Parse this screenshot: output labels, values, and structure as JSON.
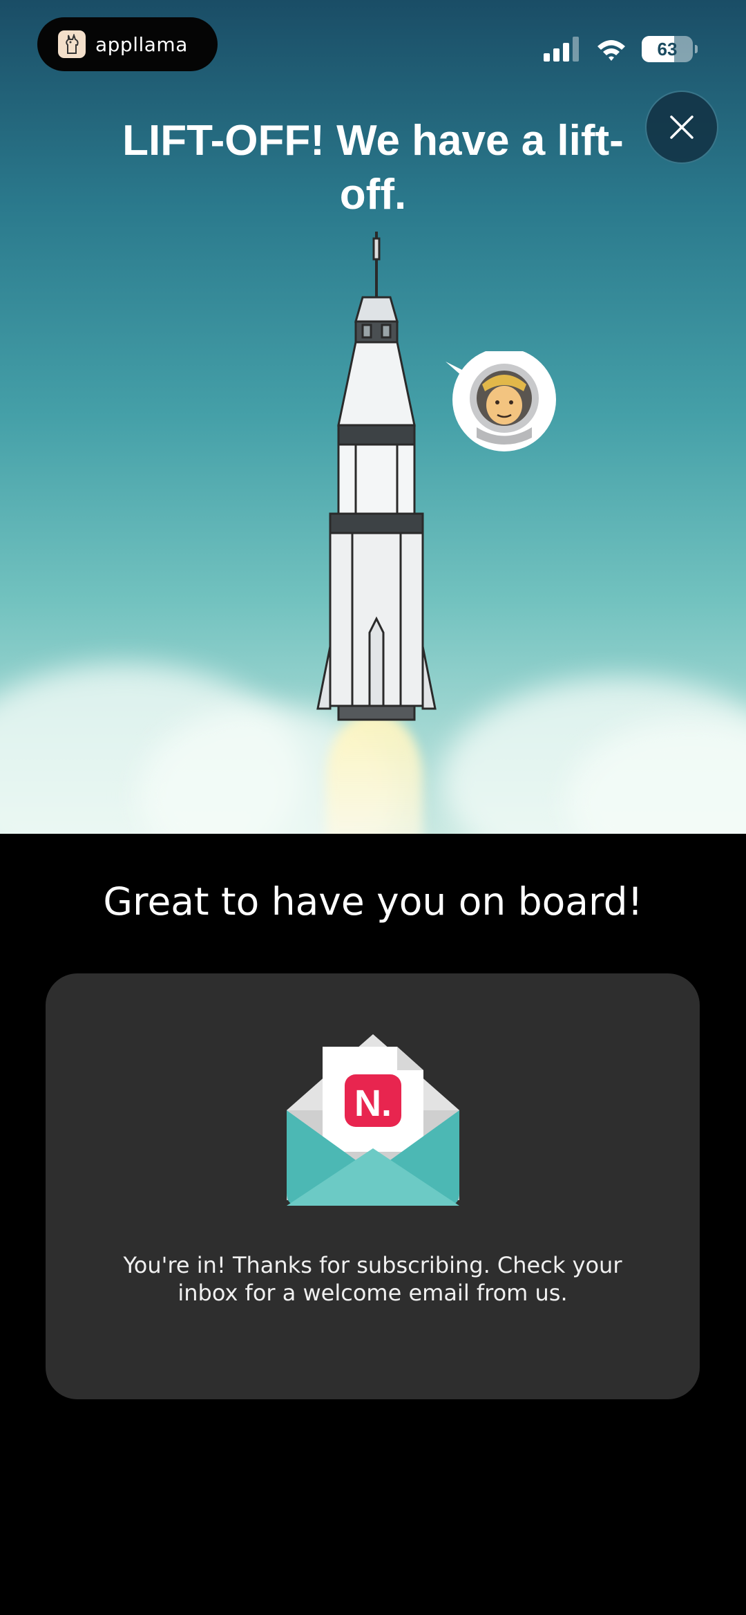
{
  "status_bar": {
    "app_pill_label": "appllama",
    "battery_level": "63"
  },
  "hero": {
    "title": "LIFT-OFF! We have a lift-off.",
    "close_icon": "close-icon",
    "astronaut_icon": "astronaut-icon",
    "rocket_image": "rocket-illustration"
  },
  "main": {
    "heading": "Great to have you on board!",
    "card": {
      "envelope_icon": "envelope-newsletter-icon",
      "message": "You're in! Thanks for subscribing. Check your inbox for a welcome email from us."
    }
  },
  "colors": {
    "sky_top": "#1a4d66",
    "sky_bottom": "#c9e9e2",
    "card_background": "#2e2e2e",
    "envelope_teal": "#4cb8b4",
    "brand_red": "#e8254f"
  }
}
